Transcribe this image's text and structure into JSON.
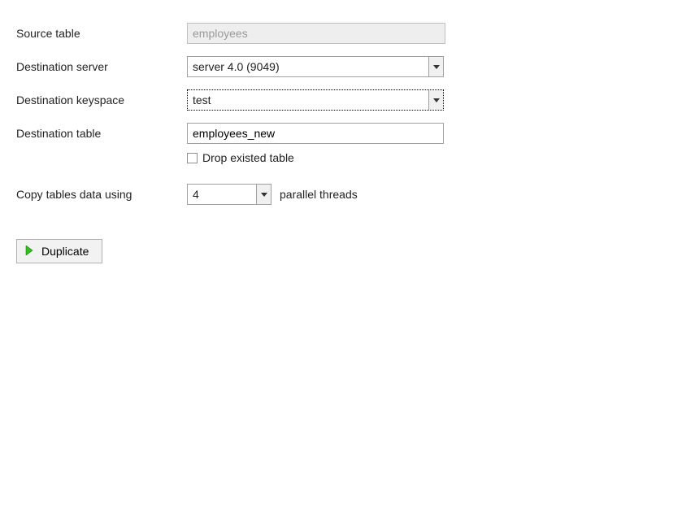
{
  "labels": {
    "source_table": "Source table",
    "destination_server": "Destination server",
    "destination_keyspace": "Destination keyspace",
    "destination_table": "Destination table",
    "copy_using": "Copy tables data using",
    "parallel_threads": "parallel threads",
    "drop_existed": "Drop existed table"
  },
  "values": {
    "source_table": "employees",
    "destination_server": "server 4.0 (9049)",
    "destination_keyspace": "test",
    "destination_table": "employees_new",
    "threads": "4",
    "drop_existed_checked": false
  },
  "buttons": {
    "duplicate": "Duplicate"
  }
}
